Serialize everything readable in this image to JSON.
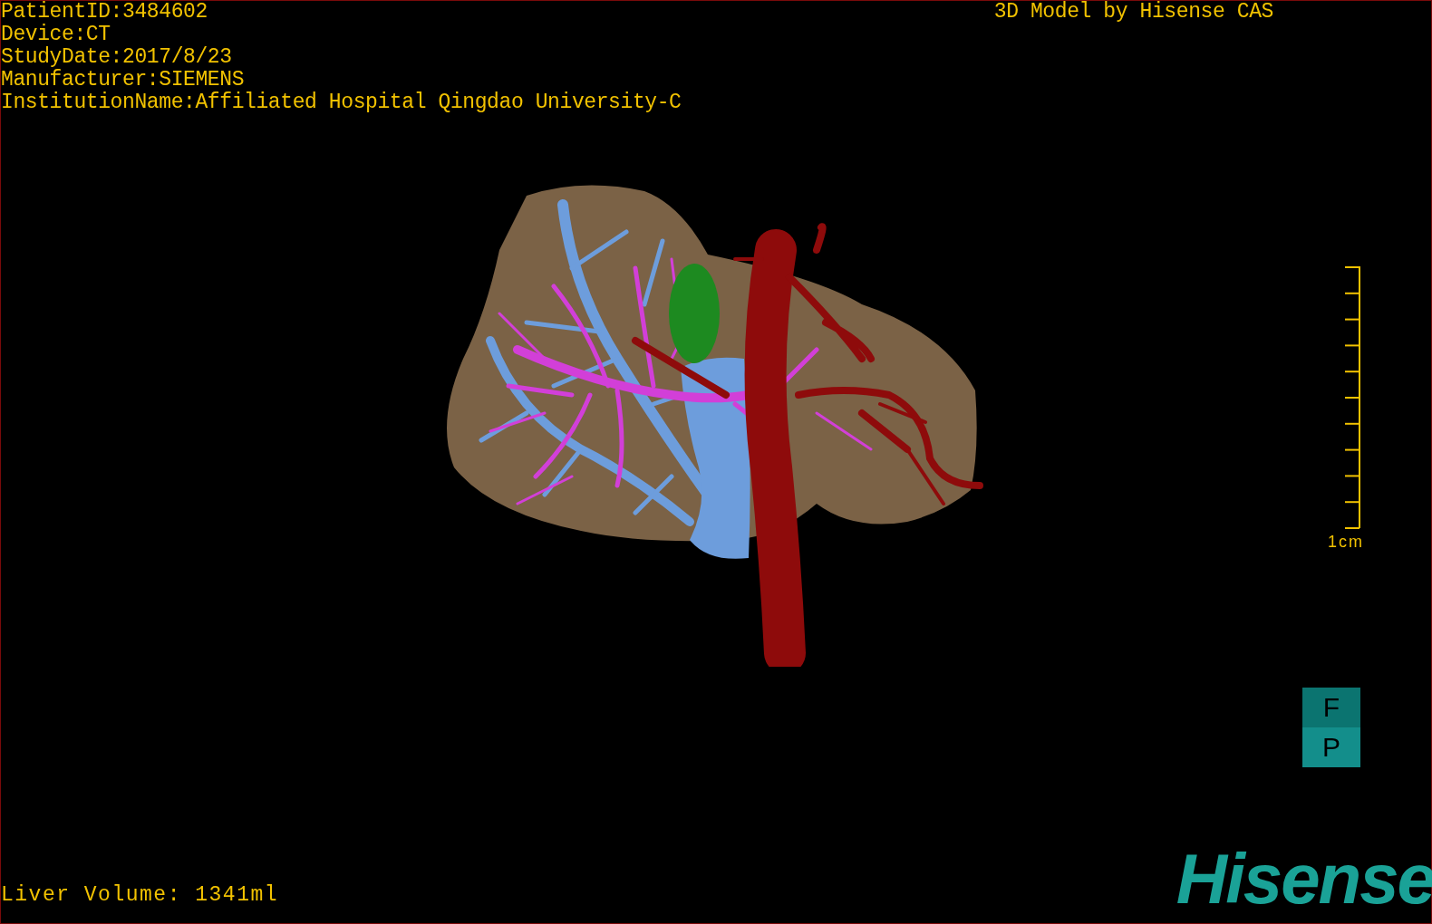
{
  "info_lines": [
    "PatientID:3484602",
    "Device:CT",
    "StudyDate:2017/8/23",
    "Manufacturer:SIEMENS",
    "InstitutionName:Affiliated Hospital Qingdao University-C"
  ],
  "credit": "3D Model by Hisense CAS",
  "scale": {
    "label": "1cm"
  },
  "orientation": {
    "top": "F",
    "bottom": "P"
  },
  "liver_volume": "Liver Volume: 1341ml",
  "logo": "Hisense"
}
